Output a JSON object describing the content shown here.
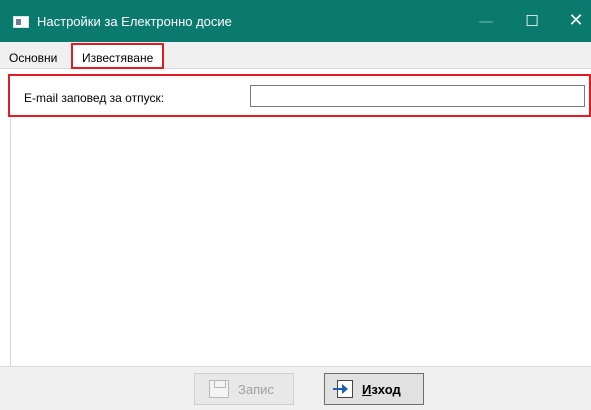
{
  "window": {
    "title": "Настройки за Електронно досие",
    "minimize_glyph": "—",
    "maximize_glyph": "☐",
    "close_glyph": "✕"
  },
  "tabs": [
    {
      "label": "Основни",
      "active": false
    },
    {
      "label": "Известяване",
      "active": true
    }
  ],
  "form": {
    "email_label": "E-mail заповед за отпуск:",
    "email_value": "",
    "email_placeholder": ""
  },
  "buttons": {
    "save_label": "Запис",
    "exit_label_first": "И",
    "exit_label_rest": "зход",
    "save_icon": "floppy-disk-icon",
    "exit_icon": "exit-arrow-icon"
  },
  "colors": {
    "titlebar": "#0a7a6e",
    "highlight": "#e31b23",
    "exit_arrow": "#1d5fb8"
  }
}
